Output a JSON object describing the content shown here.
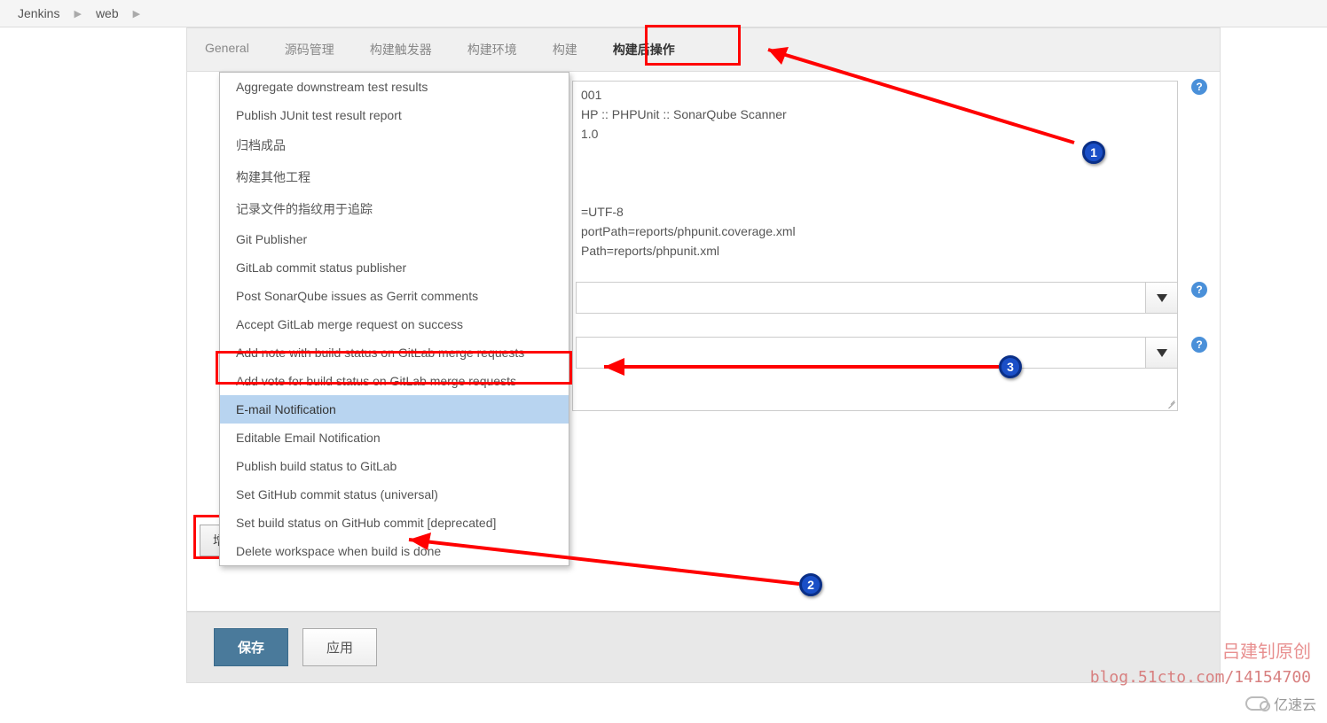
{
  "breadcrumb": {
    "items": [
      "Jenkins",
      "web"
    ]
  },
  "tabs": {
    "items": [
      {
        "label": "General"
      },
      {
        "label": "源码管理"
      },
      {
        "label": "构建触发器"
      },
      {
        "label": "构建环境"
      },
      {
        "label": "构建"
      },
      {
        "label": "构建后操作",
        "active": true
      }
    ]
  },
  "dropdown": {
    "items": [
      {
        "label": "Aggregate downstream test results"
      },
      {
        "label": "Publish JUnit test result report"
      },
      {
        "label": "归档成品"
      },
      {
        "label": "构建其他工程"
      },
      {
        "label": "记录文件的指纹用于追踪"
      },
      {
        "label": "Git Publisher"
      },
      {
        "label": "GitLab commit status publisher"
      },
      {
        "label": "Post SonarQube issues as Gerrit comments"
      },
      {
        "label": "Accept GitLab merge request on success"
      },
      {
        "label": "Add note with build status on GitLab merge requests"
      },
      {
        "label": "Add vote for build status on GitLab merge requests"
      },
      {
        "label": "E-mail Notification",
        "selected": true
      },
      {
        "label": "Editable Email Notification"
      },
      {
        "label": "Publish build status to GitLab"
      },
      {
        "label": "Set GitHub commit status (universal)"
      },
      {
        "label": "Set build status on GitHub commit [deprecated]"
      },
      {
        "label": "Delete workspace when build is done"
      }
    ]
  },
  "config_text": {
    "l1": "001",
    "l2": "HP :: PHPUnit :: SonarQube Scanner",
    "l3": "1.0",
    "l4": "=UTF-8",
    "l5": "portPath=reports/phpunit.coverage.xml",
    "l6": "Path=reports/phpunit.xml"
  },
  "add_button": {
    "label": "增加构建后操作步骤"
  },
  "footer": {
    "save": "保存",
    "apply": "应用"
  },
  "annotations": {
    "n1": "1",
    "n2": "2",
    "n3": "3"
  },
  "watermark": {
    "line1": "吕建钊原创",
    "line2": "blog.51cto.com/14154700",
    "brand": "亿速云"
  }
}
